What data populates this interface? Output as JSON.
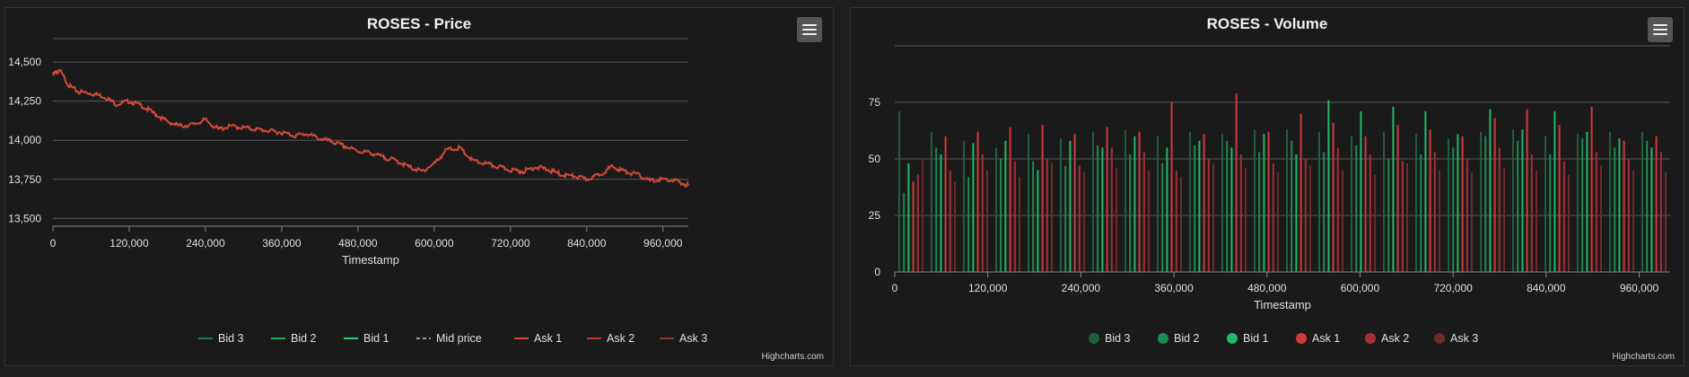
{
  "charts": [
    {
      "id": "price",
      "title": "ROSES - Price",
      "xlabel": "Timestamp",
      "credit": "Highcharts.com",
      "legend": [
        {
          "label": "Bid 3",
          "color": "#1f7a4d",
          "dash": false
        },
        {
          "label": "Bid 2",
          "color": "#1fa564",
          "dash": false
        },
        {
          "label": "Bid 1",
          "color": "#2ecc71",
          "dash": false
        },
        {
          "label": "Mid price",
          "color": "#9a9a9a",
          "dash": true
        },
        {
          "label": "Ask 1",
          "color": "#d64535",
          "dash": false
        },
        {
          "label": "Ask 2",
          "color": "#b83a30",
          "dash": false
        },
        {
          "label": "Ask 3",
          "color": "#8f3a2c",
          "dash": false
        }
      ],
      "y_ticks": [
        "13,500",
        "13,750",
        "14,000",
        "14,250",
        "14,500"
      ],
      "x_ticks": [
        "0",
        "120,000",
        "240,000",
        "360,000",
        "480,000",
        "600,000",
        "720,000",
        "840,000",
        "960,000"
      ]
    },
    {
      "id": "volume",
      "title": "ROSES - Volume",
      "xlabel": "Timestamp",
      "credit": "Highcharts.com",
      "legend": [
        {
          "label": "Bid 3",
          "color": "#1f5f3f"
        },
        {
          "label": "Bid 2",
          "color": "#1e8a55"
        },
        {
          "label": "Bid 1",
          "color": "#22b866"
        },
        {
          "label": "Ask 1",
          "color": "#d23a3a"
        },
        {
          "label": "Ask 2",
          "color": "#a82e35"
        },
        {
          "label": "Ask 3",
          "color": "#6e2a2d"
        }
      ],
      "y_ticks": [
        "0",
        "25",
        "50",
        "75"
      ],
      "x_ticks": [
        "0",
        "120,000",
        "240,000",
        "360,000",
        "480,000",
        "600,000",
        "720,000",
        "840,000",
        "960,000"
      ]
    }
  ],
  "chart_data": [
    {
      "type": "line",
      "title": "ROSES - Price",
      "xlabel": "Timestamp",
      "ylabel": "",
      "xlim": [
        0,
        999900
      ],
      "ylim": [
        13450,
        14650
      ],
      "grid": true,
      "legend_position": "bottom",
      "series": [
        {
          "name": "Ask 1",
          "x": [
            0,
            10000,
            25000,
            40000,
            60000,
            80000,
            100000,
            120000,
            140000,
            160000,
            180000,
            200000,
            220000,
            240000,
            260000,
            280000,
            300000,
            320000,
            340000,
            360000,
            380000,
            400000,
            420000,
            440000,
            460000,
            480000,
            500000,
            520000,
            540000,
            560000,
            580000,
            600000,
            620000,
            640000,
            660000,
            680000,
            700000,
            720000,
            740000,
            760000,
            780000,
            800000,
            820000,
            840000,
            860000,
            880000,
            900000,
            920000,
            940000,
            960000,
            980000,
            999900
          ],
          "values": [
            14420,
            14450,
            14350,
            14310,
            14300,
            14280,
            14230,
            14250,
            14220,
            14170,
            14120,
            14090,
            14100,
            14130,
            14070,
            14090,
            14080,
            14070,
            14060,
            14050,
            14030,
            14040,
            14010,
            13990,
            13960,
            13930,
            13920,
            13890,
            13870,
            13830,
            13800,
            13850,
            13940,
            13950,
            13870,
            13850,
            13830,
            13810,
            13800,
            13830,
            13810,
            13780,
            13770,
            13750,
            13780,
            13830,
            13800,
            13780,
            13740,
            13750,
            13740,
            13710
          ]
        }
      ]
    },
    {
      "type": "bar",
      "title": "ROSES - Volume",
      "xlabel": "Timestamp",
      "ylabel": "",
      "xlim": [
        0,
        999900
      ],
      "ylim": [
        0,
        100
      ],
      "grid": true,
      "legend_position": "bottom",
      "series": [
        {
          "name": "Bid 3",
          "values": [
            71,
            62,
            58,
            55,
            61,
            59,
            62,
            63,
            60,
            62,
            61,
            63,
            63,
            62,
            60,
            62,
            61,
            59,
            62,
            63,
            60,
            61,
            62,
            62
          ]
        },
        {
          "name": "Bid 2",
          "values": [
            35,
            55,
            42,
            50,
            49,
            47,
            56,
            52,
            48,
            56,
            58,
            53,
            58,
            53,
            56,
            50,
            52,
            55,
            60,
            58,
            52,
            59,
            55,
            58
          ]
        },
        {
          "name": "Bid 1",
          "values": [
            48,
            52,
            57,
            58,
            45,
            58,
            55,
            60,
            55,
            58,
            55,
            61,
            52,
            76,
            71,
            73,
            71,
            61,
            72,
            63,
            71,
            62,
            59,
            55
          ]
        },
        {
          "name": "Ask 1",
          "values": [
            40,
            60,
            62,
            64,
            65,
            61,
            64,
            62,
            75,
            61,
            79,
            62,
            70,
            66,
            60,
            65,
            63,
            60,
            68,
            72,
            65,
            73,
            58,
            60
          ]
        },
        {
          "name": "Ask 2",
          "values": [
            43,
            45,
            52,
            49,
            50,
            47,
            55,
            53,
            45,
            50,
            52,
            48,
            50,
            55,
            52,
            49,
            53,
            50,
            55,
            52,
            49,
            53,
            50,
            53
          ]
        },
        {
          "name": "Ask 3",
          "values": [
            50,
            40,
            45,
            42,
            48,
            44,
            46,
            45,
            42,
            48,
            46,
            44,
            47,
            45,
            43,
            48,
            45,
            44,
            46,
            45,
            43,
            47,
            45,
            44
          ]
        }
      ]
    }
  ]
}
